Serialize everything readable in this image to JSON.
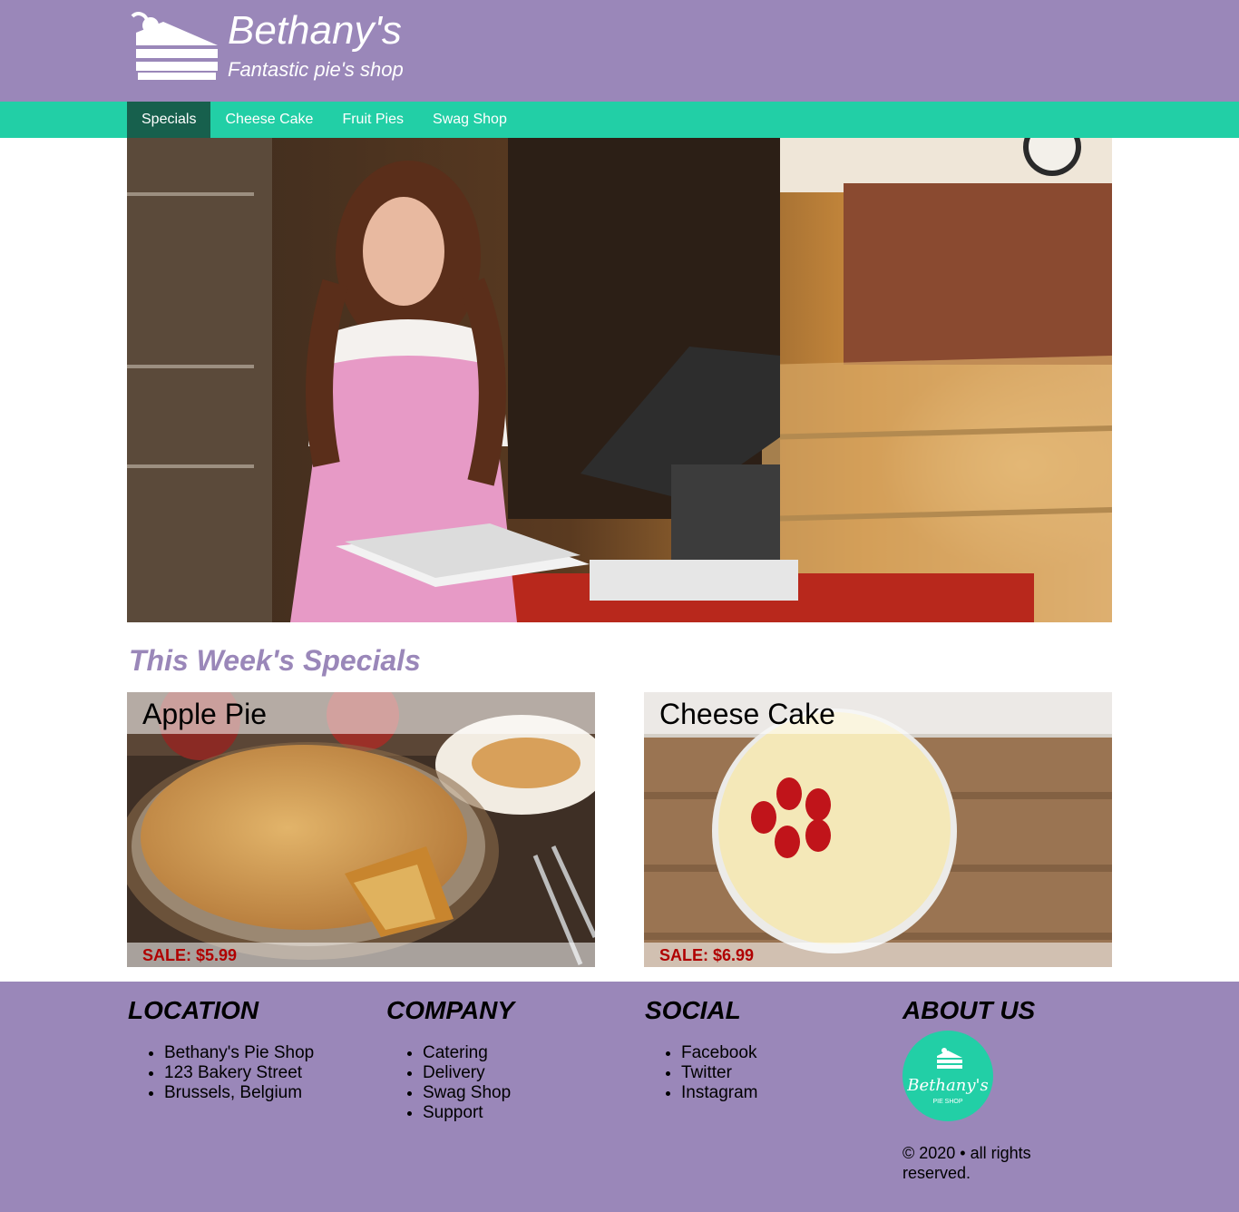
{
  "header": {
    "brand_name": "Bethany's",
    "tagline": "Fantastic pie's shop",
    "logo_icon": "cake-slice-icon"
  },
  "nav": {
    "items": [
      {
        "label": "Specials",
        "active": true
      },
      {
        "label": "Cheese Cake",
        "active": false
      },
      {
        "label": "Fruit Pies",
        "active": false
      },
      {
        "label": "Swag Shop",
        "active": false
      }
    ]
  },
  "hero": {
    "alt": "Bakery shop counter photo"
  },
  "specials": {
    "title": "This Week's Specials",
    "cards": [
      {
        "name": "Apple Pie",
        "price": "SALE: $5.99"
      },
      {
        "name": "Cheese Cake",
        "price": "SALE: $6.99"
      }
    ]
  },
  "footer": {
    "location": {
      "heading": "LOCATION",
      "items": [
        "Bethany's Pie Shop",
        "123 Bakery Street",
        "Brussels, Belgium"
      ]
    },
    "company": {
      "heading": "COMPANY",
      "items": [
        "Catering",
        "Delivery",
        "Swag Shop",
        "Support"
      ]
    },
    "social": {
      "heading": "SOCIAL",
      "items": [
        "Facebook",
        "Twitter",
        "Instagram"
      ]
    },
    "about": {
      "heading": "ABOUT US",
      "logo_text": "Bethany's",
      "logo_subtext": "PIE SHOP",
      "copyright": "© 2020 • all rights reserved."
    }
  },
  "colors": {
    "header_bg": "#9a87b9",
    "nav_bg": "#22cfa6",
    "nav_active_bg": "#17604d",
    "title_color": "#9a87b9",
    "price_color": "#b00000"
  }
}
